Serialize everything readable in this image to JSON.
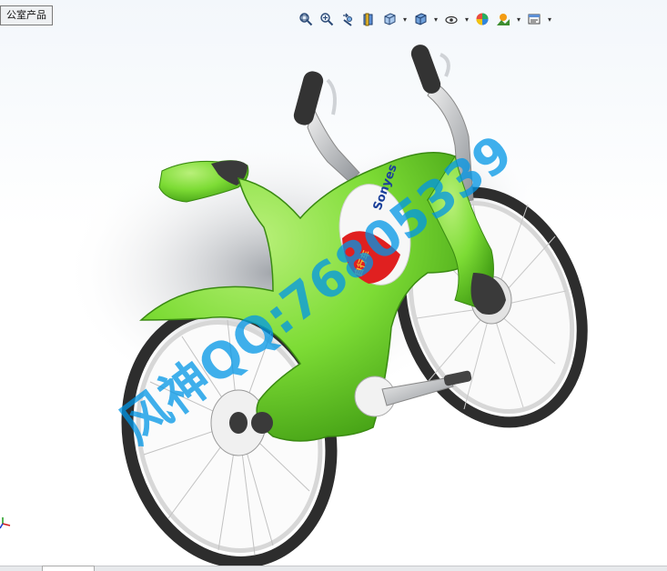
{
  "window": {
    "tab_label": "公室产品"
  },
  "toolbar": {
    "buttons": [
      {
        "icon": "zoom-to-fit-icon"
      },
      {
        "icon": "zoom-to-area-icon"
      },
      {
        "icon": "previous-view-icon"
      },
      {
        "icon": "section-view-icon"
      },
      {
        "icon": "view-orientation-icon",
        "dropdown": true
      },
      {
        "icon": "display-style-icon",
        "dropdown": true
      },
      {
        "icon": "hide-show-items-icon",
        "dropdown": true
      },
      {
        "icon": "edit-appearance-icon"
      },
      {
        "icon": "apply-scene-icon",
        "dropdown": true
      },
      {
        "icon": "view-settings-icon",
        "dropdown": true
      }
    ]
  },
  "model": {
    "badge_text_1": "Sonyes",
    "badge_text_2": "自行车",
    "colors": {
      "frame": "#7ddc35",
      "frame_dark": "#4aa81a",
      "seat": "#3a3a3a",
      "tire": "#2d2d2d",
      "rim": "#e6e6e6",
      "handlebar": "#c9ccd0",
      "badge_red": "#e02020"
    }
  },
  "watermark": {
    "text": "风神QQ:76805339"
  }
}
